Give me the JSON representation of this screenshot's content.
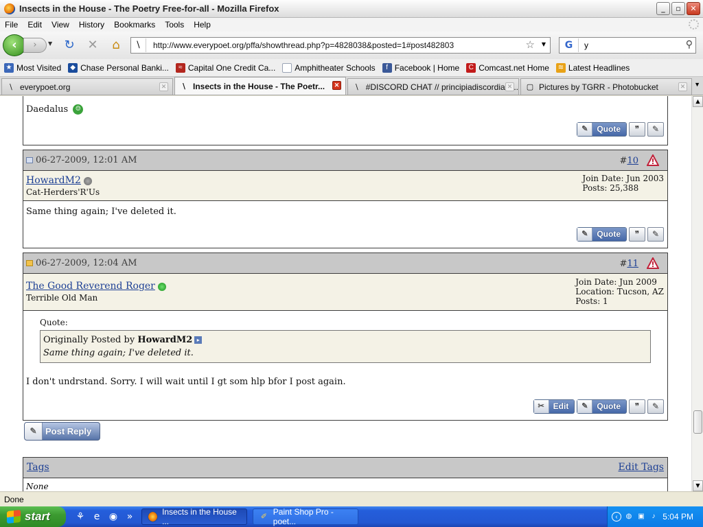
{
  "window": {
    "title": "Insects in the House - The Poetry Free-for-all - Mozilla Firefox",
    "buttons": {
      "minimize": "_",
      "maximize": "▫",
      "close": "✕"
    }
  },
  "menubar": [
    "File",
    "Edit",
    "View",
    "History",
    "Bookmarks",
    "Tools",
    "Help"
  ],
  "navbar": {
    "url": "http://www.everypoet.org/pffa/showthread.php?p=4828038&posted=1#post482803",
    "search_engine": "G",
    "search_value": "y"
  },
  "bookmarks": [
    {
      "label": "Most Visited",
      "icon": "bookmark-icon",
      "color": "#3b67b8"
    },
    {
      "label": "Chase Personal Banki...",
      "icon": "chase-icon",
      "color": "#1a4c9c"
    },
    {
      "label": "Capital One Credit Ca...",
      "icon": "capitalone-icon",
      "color": "#b3261e"
    },
    {
      "label": "Amphitheater Schools",
      "icon": "page-icon",
      "color": "#9aa4b5"
    },
    {
      "label": "Facebook | Home",
      "icon": "facebook-icon",
      "color": "#3b5998"
    },
    {
      "label": "Comcast.net Home",
      "icon": "comcast-icon",
      "color": "#c21b1b"
    },
    {
      "label": "Latest Headlines",
      "icon": "rss-icon",
      "color": "#e8a217"
    }
  ],
  "tabs": [
    {
      "label": "everypoet.org",
      "active": false
    },
    {
      "label": "Insects in the House - The Poetr...",
      "active": true
    },
    {
      "label": "#DISCORD CHAT // principiadiscordia.c...",
      "active": false
    },
    {
      "label": "Pictures by TGRR - Photobucket",
      "active": false
    }
  ],
  "thread": {
    "prev_post": {
      "author": "Daedalus"
    },
    "buttons": {
      "quote": "Quote",
      "edit": "Edit",
      "post_reply": "Post Reply"
    },
    "posts": [
      {
        "date": "06-27-2009, 12:01 AM",
        "number_prefix": "#",
        "number": "10",
        "user": "HowardM2",
        "user_title": "Cat-Herders'R'Us",
        "info": [
          "Join Date: Jun 2003",
          "Posts: 25,388"
        ],
        "body": "Same thing again; I've deleted it."
      },
      {
        "date": "06-27-2009, 12:04 AM",
        "number_prefix": "#",
        "number": "11",
        "user": "The Good Reverend Roger",
        "user_title": "Terrible Old Man",
        "info": [
          "Join Date: Jun 2009",
          "Location: Tucson, AZ",
          "Posts: 1"
        ],
        "quote_label": "Quote:",
        "quote_prefix": "Originally Posted by",
        "quote_author": "HowardM2",
        "quote_text": "Same thing again; I've deleted it.",
        "body": "I don't undrstand. Sorry. I will wait until I gt som hlp bfor I post again."
      }
    ],
    "tags": {
      "title": "Tags",
      "edit": "Edit Tags",
      "value": "None"
    }
  },
  "statusbar": {
    "text": "Done"
  },
  "taskbar": {
    "start": "start",
    "tasks": [
      {
        "label": "Insects in the House ...",
        "active": true
      },
      {
        "label": "Paint Shop Pro - poet...",
        "active": false
      }
    ],
    "clock": "5:04 PM"
  }
}
